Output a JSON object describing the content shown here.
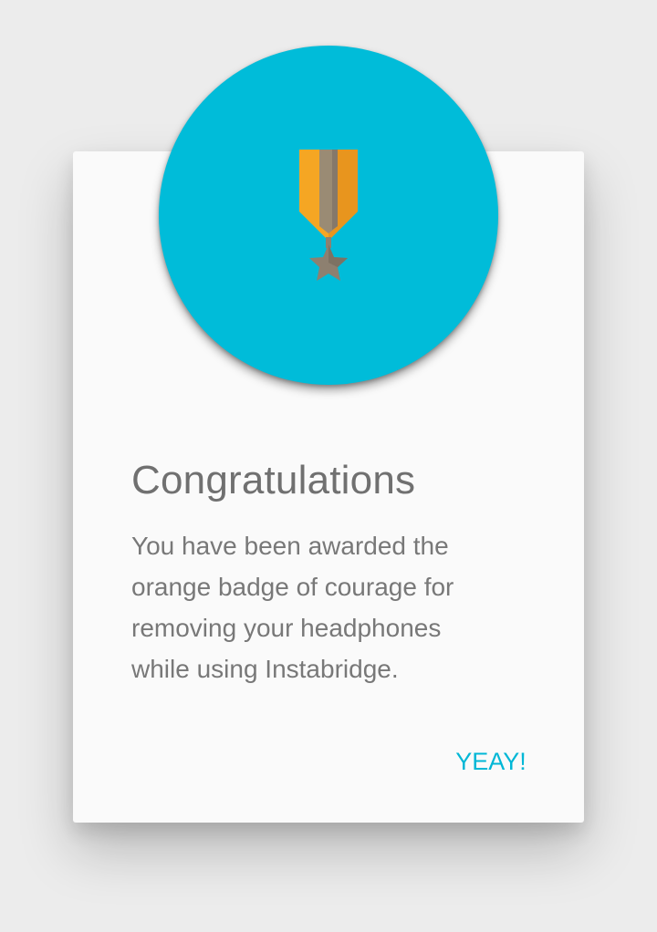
{
  "dialog": {
    "title": "Congratulations",
    "message": "You have been awarded the orange badge of courage for removing your headphones while using Instabridge.",
    "confirm_label": "YEAY!"
  },
  "badge": {
    "icon": "medal-icon",
    "circle_color": "#00bcd9",
    "ribbon_color": "#f5a623",
    "star_color": "#8d8070"
  }
}
